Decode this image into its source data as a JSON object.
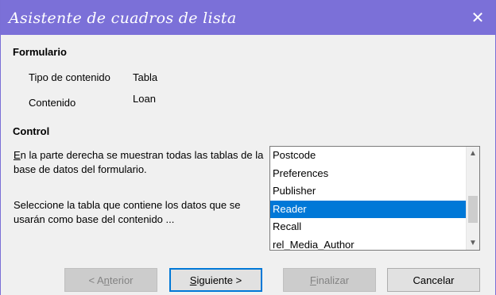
{
  "window": {
    "title": "Asistente de cuadros de lista",
    "close_glyph": "✕"
  },
  "form": {
    "heading": "Formulario",
    "content_type_label": "Tipo de contenido",
    "content_type_value": "Tabla",
    "content_label": "Contenido",
    "content_value": "Loan"
  },
  "control": {
    "heading": "Control",
    "desc1_first": "E",
    "desc1_rest": "n la parte derecha se muestran todas las tablas de la base de datos del formulario.",
    "desc2": "Seleccione la tabla que contiene los datos que se usarán como base del contenido ..."
  },
  "tables": {
    "items": [
      "Postcode",
      "Preferences",
      "Publisher",
      "Reader",
      "Recall",
      "rel_Media_Author"
    ],
    "selected": "Reader"
  },
  "buttons": {
    "back": {
      "pre": "< A",
      "mnemonic": "n",
      "post": "terior"
    },
    "next": {
      "pre": "",
      "mnemonic": "S",
      "post": "iguiente >"
    },
    "finish": {
      "pre": "",
      "mnemonic": "F",
      "post": "inalizar"
    },
    "cancel": "Cancelar"
  },
  "colors": {
    "titlebar": "#7b70d8",
    "selection": "#0078d7"
  }
}
